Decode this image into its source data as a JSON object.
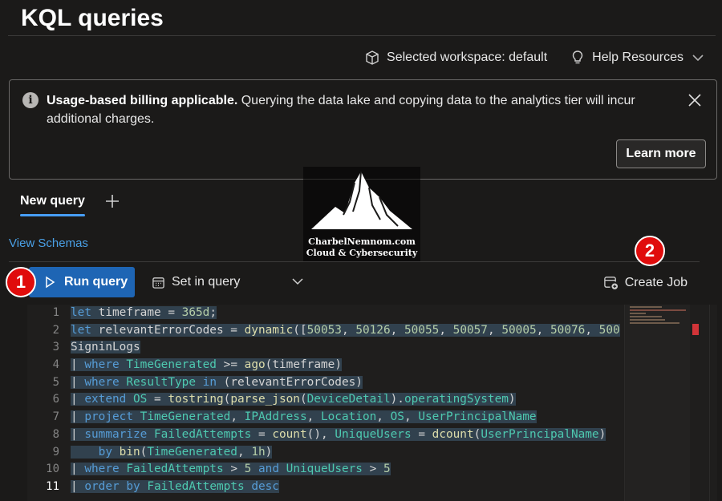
{
  "page": {
    "title": "KQL queries"
  },
  "toolbar": {
    "workspace_label": "Selected workspace: default",
    "help_label": "Help Resources"
  },
  "banner": {
    "bold_text": "Usage-based billing applicable.",
    "text": " Querying the data lake and copying data to the analytics tier will incur additional charges.",
    "learn_more_label": "Learn more"
  },
  "tabs": [
    {
      "label": "New query",
      "active": true
    }
  ],
  "schemas_link": "View Schemas",
  "actions": {
    "run_label": "Run query",
    "set_in_query_label": "Set in query",
    "create_job_label": "Create Job"
  },
  "callouts": {
    "step1": "1",
    "step2": "2"
  },
  "watermark": {
    "line1": "CharbelNemnom.com",
    "line2": "Cloud & Cybersecurity"
  },
  "editor": {
    "line_numbers": [
      "1",
      "2",
      "3",
      "4",
      "5",
      "6",
      "7",
      "8",
      "9",
      "10",
      "11"
    ],
    "lines": [
      "let timeframe = 365d;",
      "let relevantErrorCodes = dynamic([50053, 50126, 50055, 50057, 50005, 50076, 500",
      "SigninLogs",
      "| where TimeGenerated >= ago(timeframe)",
      "| where ResultType in (relevantErrorCodes)",
      "| extend OS = tostring(parse_json(DeviceDetail).operatingSystem)",
      "| project TimeGenerated, IPAddress, Location, OS, UserPrincipalName",
      "| summarize FailedAttempts = count(), UniqueUsers = dcount(UserPrincipalName)",
      "    by bin(TimeGenerated, 1h)",
      "| where FailedAttempts > 5 and UniqueUsers > 5",
      "| order by FailedAttempts desc"
    ]
  },
  "colors": {
    "accent": "#479ef5",
    "run_button": "#1e65b4",
    "callout": "#e00c0c",
    "background": "#1b1a19"
  }
}
